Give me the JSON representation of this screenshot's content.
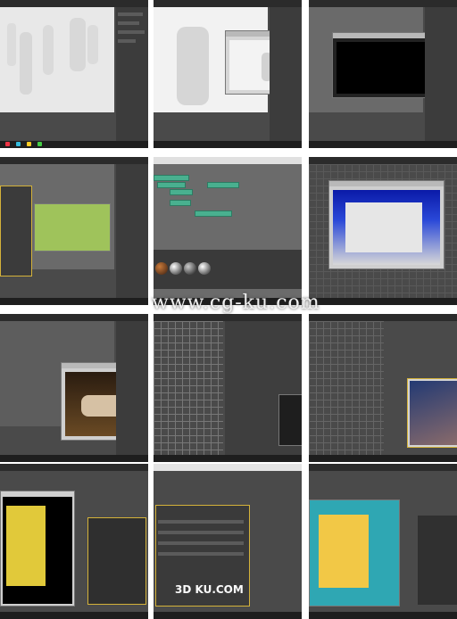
{
  "watermark_text": "www.cg-ku.com",
  "brand_text": "3D KU.COM",
  "colors": {
    "ui_dark": "#4a4a4a",
    "viewport_gray": "#6a6a6a",
    "node_green": "#49b08f",
    "preview_green": "#9fc35b"
  }
}
